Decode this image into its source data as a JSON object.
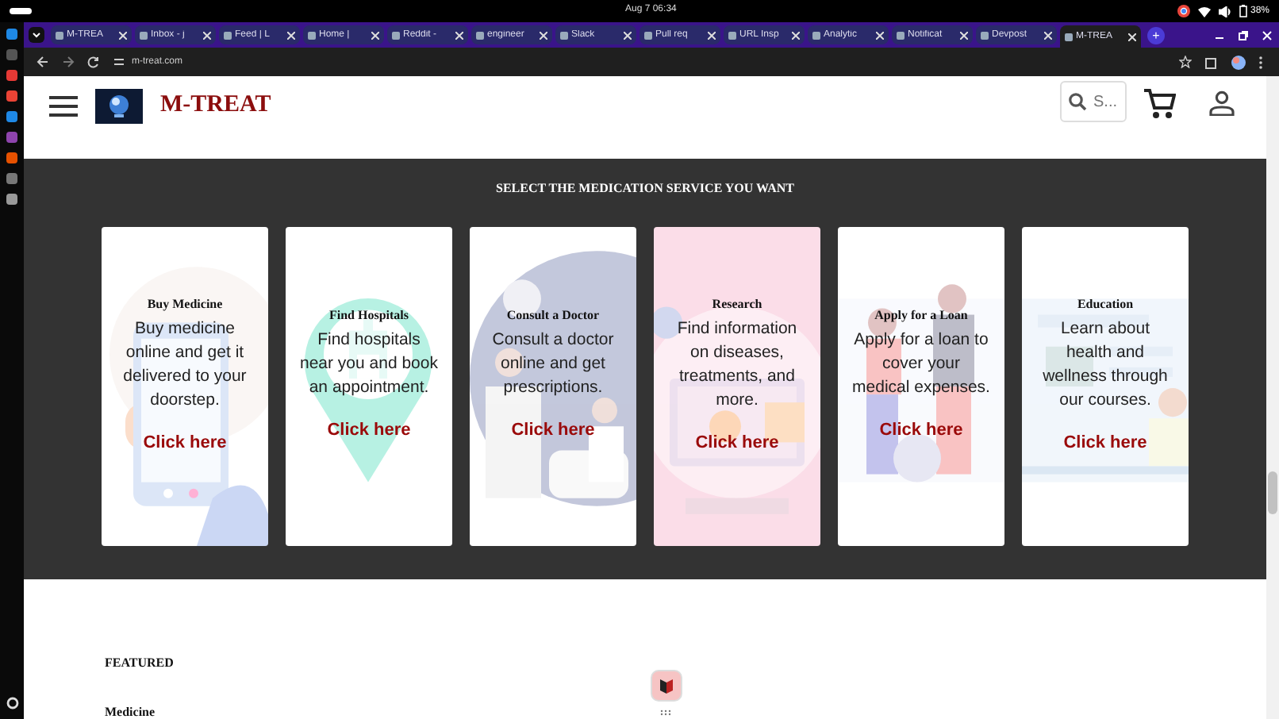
{
  "system_bar": {
    "clock": "Aug 7  06:34",
    "battery": "38%"
  },
  "tabs": [
    {
      "title": "M-TREA",
      "selected": false
    },
    {
      "title": "Inbox - j",
      "selected": false
    },
    {
      "title": "Feed | L",
      "selected": false
    },
    {
      "title": "Home | ",
      "selected": false
    },
    {
      "title": "Reddit -",
      "selected": false
    },
    {
      "title": "engineer",
      "selected": false
    },
    {
      "title": "Slack",
      "selected": false
    },
    {
      "title": "Pull req",
      "selected": false
    },
    {
      "title": "URL Insp",
      "selected": false
    },
    {
      "title": "Analytic",
      "selected": false
    },
    {
      "title": "Notificat",
      "selected": false
    },
    {
      "title": "Devpost",
      "selected": false
    },
    {
      "title": "M-TREA",
      "selected": true
    }
  ],
  "new_tab": "+",
  "address_bar": {
    "url": "m-treat.com"
  },
  "header": {
    "brand": "M-TREAT",
    "search": {
      "placeholder": "S..."
    }
  },
  "services": {
    "heading": "SELECT THE MEDICATION SERVICE YOU WANT",
    "cards": [
      {
        "kind": "phone",
        "color": "#ffffff",
        "title": "Buy Medicine",
        "description": "Buy medicine online and get it delivered to your doorstep.",
        "link": "Click here"
      },
      {
        "kind": "pin",
        "color": "#ffffff",
        "title": "Find Hospitals",
        "description": "Find hospitals near you and book an appointment.",
        "link": "Click here"
      },
      {
        "kind": "doctor",
        "color": "#ffffff",
        "title": "Consult a Doctor",
        "description": "Consult a doctor online and get prescriptions.",
        "link": "Click here"
      },
      {
        "kind": "research",
        "color": "#fbdde8",
        "title": "Research",
        "description": "Find information on diseases, treatments, and more.",
        "link": "Click here"
      },
      {
        "kind": "loan",
        "color": "#ffffff",
        "title": "Apply for a Loan",
        "description": "Apply for a loan to cover your medical expenses.",
        "link": "Click here"
      },
      {
        "kind": "education",
        "color": "#ffffff",
        "title": "Education",
        "description": "Learn about health and wellness through our courses.",
        "link": "Click here"
      }
    ]
  },
  "featured": {
    "heading": "FEATURED",
    "items": [
      "Medicine"
    ]
  }
}
